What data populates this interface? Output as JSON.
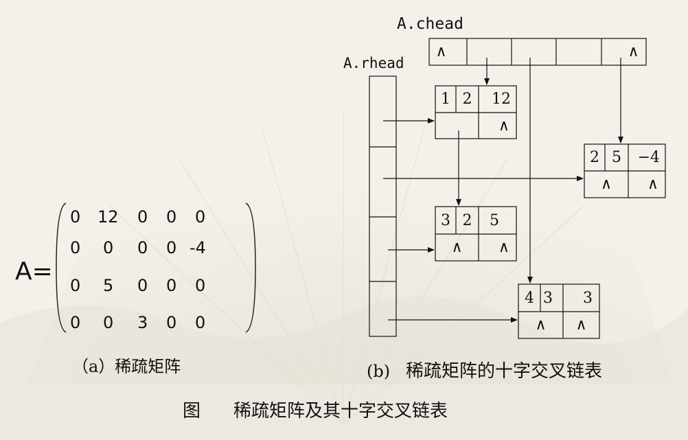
{
  "matrix": {
    "prefix": "A=",
    "rows": [
      [
        "0",
        "12",
        "0",
        "0",
        "0"
      ],
      [
        "0",
        "0",
        "0",
        "0",
        "-4"
      ],
      [
        "0",
        "5",
        "0",
        "0",
        "0"
      ],
      [
        "0",
        "0",
        "3",
        "0",
        "0"
      ]
    ]
  },
  "captions": {
    "a": "（a）稀疏矩阵",
    "b_marker": "(b)",
    "b": "稀疏矩阵的十字交叉链表",
    "figure_label": "图",
    "figure_title": "稀疏矩阵及其十字交叉链表"
  },
  "list": {
    "chead_label": "A.chead",
    "rhead_label": "A.rhead",
    "null_symbol": "∧",
    "nodes": [
      {
        "i": "1",
        "j": "2",
        "e": "12",
        "down": "",
        "right": "∧"
      },
      {
        "i": "2",
        "j": "5",
        "e": "−4",
        "down": "∧",
        "right": "∧"
      },
      {
        "i": "3",
        "j": "2",
        "e": "5",
        "down": "∧",
        "right": "∧"
      },
      {
        "i": "4",
        "j": "3",
        "e": "3",
        "down": "∧",
        "right": "∧"
      }
    ],
    "chead_cells": [
      "∧",
      "",
      "",
      "",
      "∧"
    ]
  }
}
